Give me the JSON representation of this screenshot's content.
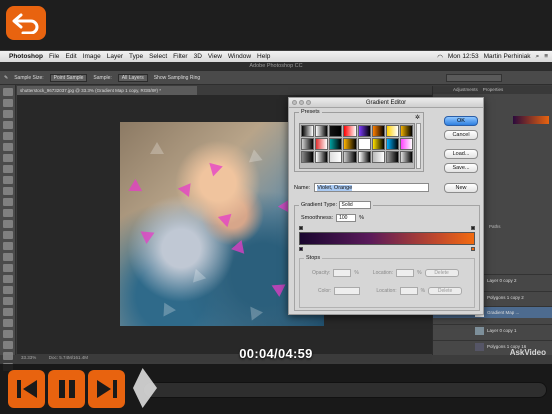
{
  "top": {
    "back_icon": "back-arrow-icon"
  },
  "menubar": {
    "app": "Photoshop",
    "items": [
      "File",
      "Edit",
      "Image",
      "Layer",
      "Type",
      "Select",
      "Filter",
      "3D",
      "View",
      "Window",
      "Help"
    ],
    "clock": "Mon 12:53",
    "user": "Martin Perhiniak"
  },
  "ps": {
    "window_title": "Adobe Photoshop CC",
    "options": {
      "sample_size_label": "Sample Size:",
      "sample_size": "Point Sample",
      "sample_label": "Sample:",
      "sample": "All Layers",
      "show_ring": "Show Sampling Ring"
    },
    "doc_tab": "shutterstock_96732037.jpg @ 33.3% (Gradient Map 1 copy, RGB/8#) *",
    "status_zoom": "33.33%",
    "status_doc": "Doc: 5.74M/161.4M",
    "panels": {
      "tabs": [
        "Adjustments",
        "Properties"
      ],
      "layers_tab": "Paths",
      "layers": [
        {
          "name": "Layer 0 copy 2"
        },
        {
          "name": "Polygons 1 copy 2"
        },
        {
          "name": "Gradient Map ..."
        },
        {
          "name": "Layer 0 copy 1"
        },
        {
          "name": "Polygons 1 copy 16"
        }
      ]
    }
  },
  "dialog": {
    "title": "Gradient Editor",
    "presets_label": "Presets",
    "ok": "OK",
    "cancel": "Cancel",
    "load": "Load...",
    "save": "Save...",
    "new": "New",
    "name_label": "Name:",
    "name_value": "Violet, Orange",
    "gradient_type_label": "Gradient Type:",
    "gradient_type": "Solid",
    "smoothness_label": "Smoothness:",
    "smoothness": "100",
    "smoothness_unit": "%",
    "stops_label": "Stops",
    "opacity_label": "Opacity:",
    "location_label": "Location:",
    "color_label": "Color:",
    "percent": "%",
    "delete": "Delete",
    "swatch_colors": [
      "#000000",
      "#ffffff",
      "#111111",
      "#ff0000",
      "#7d3cff",
      "#ff8000",
      "#ffd000",
      "#f0b000",
      "#d0d0d0",
      "#e03030",
      "#00a0a0",
      "#ffb300",
      "#ffffff",
      "#ffe000",
      "#00b0ff",
      "#ff40ff",
      "#888888",
      "#ffffff",
      "#dddddd",
      "#cccccc",
      "#ffffff",
      "#bbbbbb",
      "#999999",
      "#e0e0e0"
    ]
  },
  "video": {
    "timecode": "00:04/04:59",
    "watermark": "AskVideo",
    "progress": 0.0134
  }
}
